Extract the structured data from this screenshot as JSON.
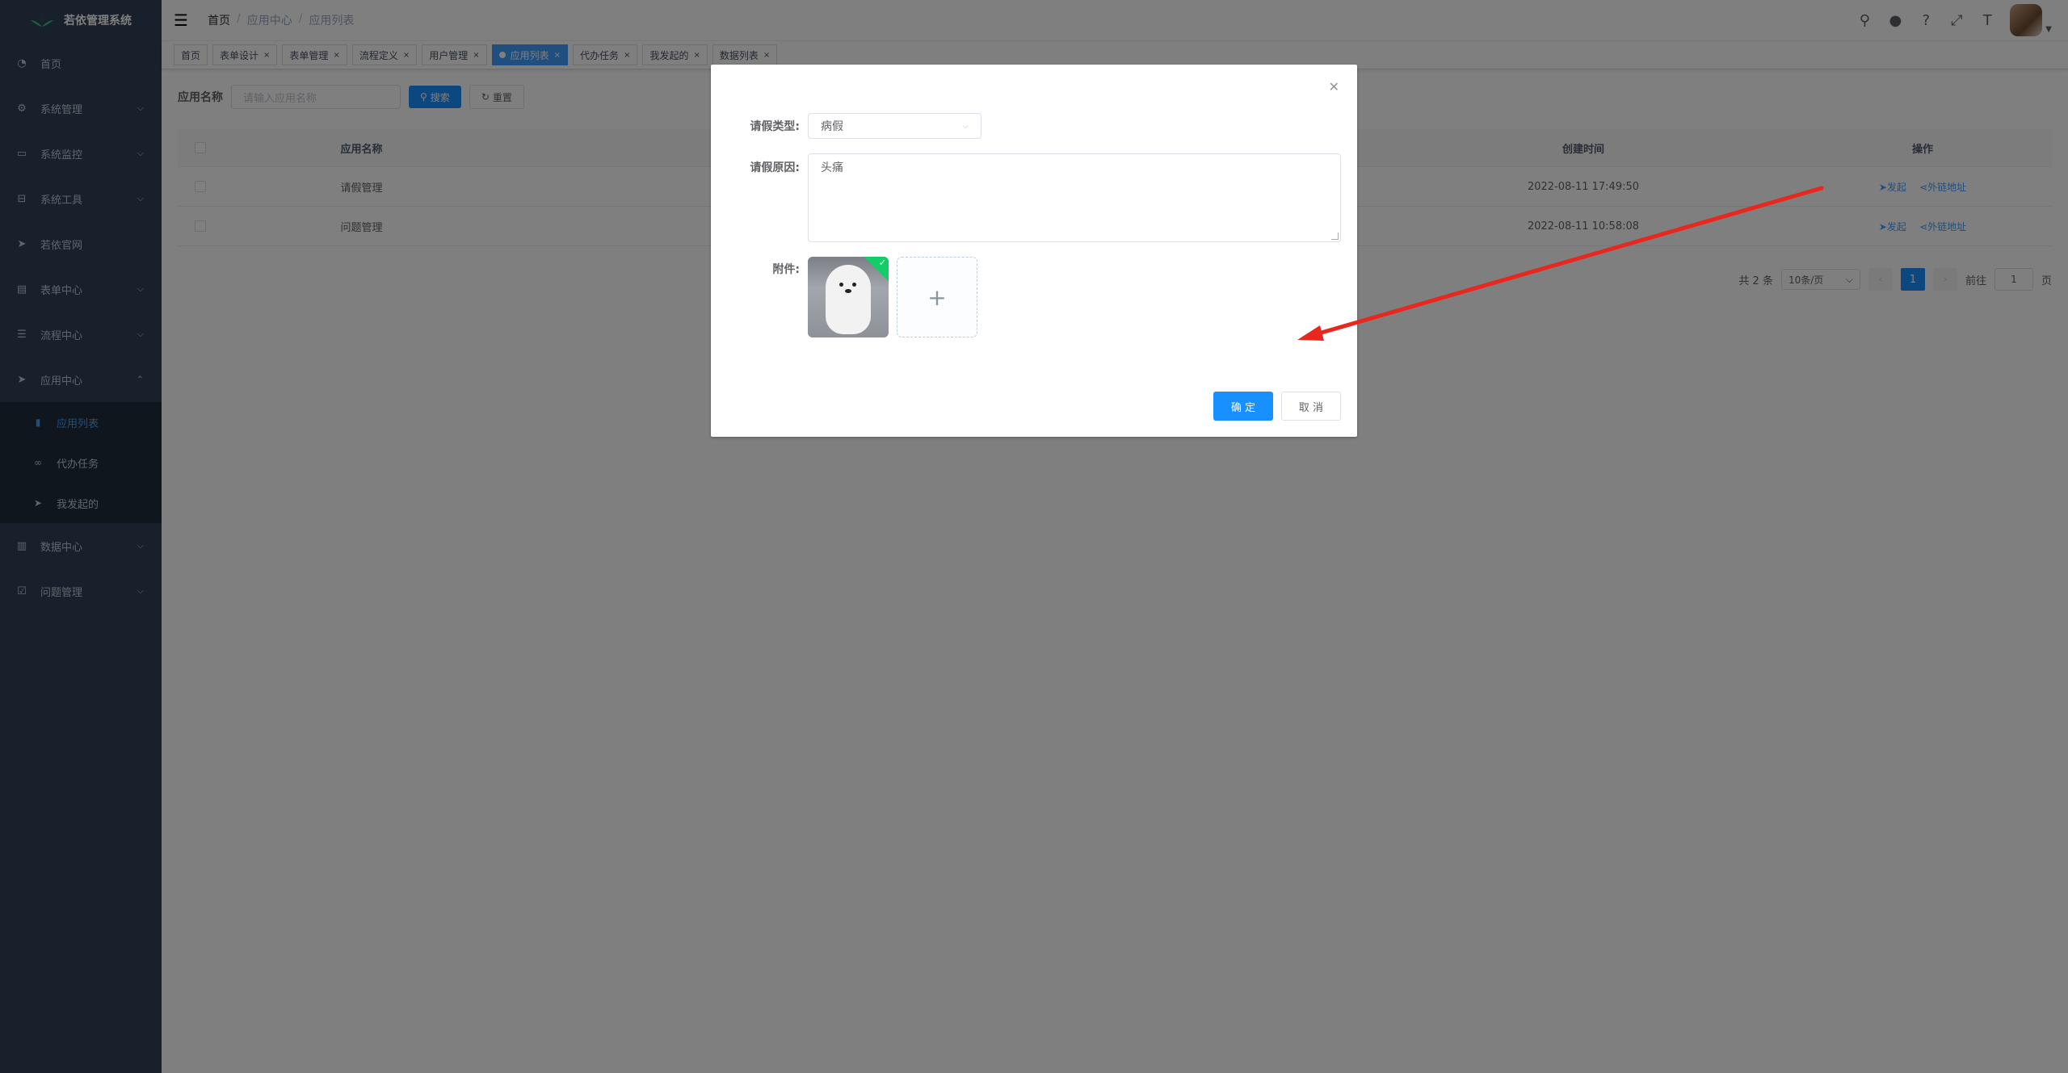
{
  "colors": {
    "sidebar_bg": "#304156",
    "primary": "#1890ff",
    "success": "#13ce66",
    "annotation": "#e8271e"
  },
  "sidebar": {
    "logo_icon": "logo-leaf-icon",
    "app_title": "若依管理系统",
    "items": [
      {
        "label": "首页",
        "icon": "dashboard-icon"
      },
      {
        "label": "系统管理",
        "icon": "gear-icon"
      },
      {
        "label": "系统监控",
        "icon": "monitor-icon"
      },
      {
        "label": "系统工具",
        "icon": "toolbox-icon"
      },
      {
        "label": "若依官网",
        "icon": "send-icon"
      },
      {
        "label": "表单中心",
        "icon": "form-icon"
      },
      {
        "label": "流程中心",
        "icon": "flow-icon"
      },
      {
        "label": "应用中心",
        "icon": "send-icon"
      },
      {
        "label": "数据中心",
        "icon": "data-icon"
      },
      {
        "label": "问题管理",
        "icon": "issue-icon"
      }
    ],
    "app_center_sub": [
      {
        "label": "应用列表",
        "icon": "list-icon"
      },
      {
        "label": "代办任务",
        "icon": "link-icon"
      },
      {
        "label": "我发起的",
        "icon": "send-icon"
      }
    ]
  },
  "navbar": {
    "breadcrumb": [
      "首页",
      "应用中心",
      "应用列表"
    ]
  },
  "tags": [
    "首页",
    "表单设计",
    "表单管理",
    "流程定义",
    "用户管理",
    "应用列表",
    "代办任务",
    "我发起的",
    "数据列表"
  ],
  "search": {
    "label": "应用名称",
    "placeholder": "请输入应用名称",
    "search_btn": "搜索",
    "reset_btn": "重置"
  },
  "table": {
    "headers": {
      "name": "应用名称",
      "time": "创建时间",
      "op": "操作"
    },
    "rows": [
      {
        "name": "请假管理",
        "time": "2022-08-11 17:49:50",
        "op1": "发起",
        "op2": "外链地址"
      },
      {
        "name": "问题管理",
        "time": "2022-08-11 10:58:08",
        "op1": "发起",
        "op2": "外链地址"
      }
    ]
  },
  "pagination": {
    "total": "共 2 条",
    "page_size": "10条/页",
    "current": "1",
    "goto_prefix": "前往",
    "goto_value": "1",
    "goto_suffix": "页"
  },
  "dialog": {
    "leave_type_label": "请假类型:",
    "leave_type_value": "病假",
    "reason_label": "请假原因:",
    "reason_value": "头痛",
    "attachment_label": "附件:",
    "confirm_btn": "确 定",
    "cancel_btn": "取 消"
  }
}
